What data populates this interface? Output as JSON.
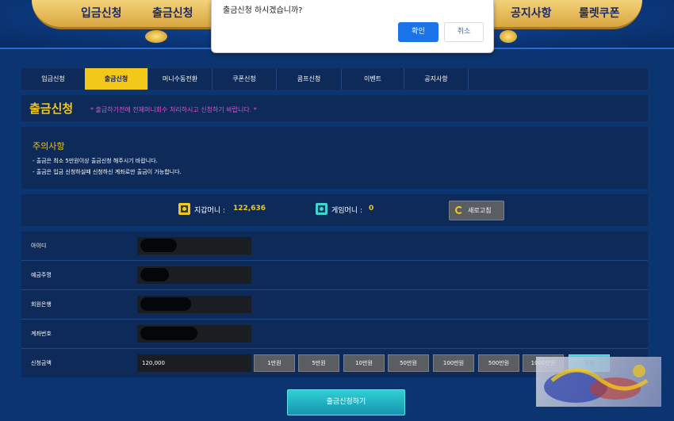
{
  "topnav": {
    "items": [
      "입금신청",
      "출금신청",
      "공지사항",
      "룰렛쿠폰"
    ]
  },
  "tabs": [
    "입금신청",
    "출금신청",
    "머니수동전환",
    "쿠폰신청",
    "콤프신청",
    "이벤트",
    "공지사항"
  ],
  "active_tab": "출금신청",
  "title": {
    "text": "출금신청",
    "note": "* 출금하기전에 전체머니회수 처리하시고 신청하기 바랍니다. *"
  },
  "notice": {
    "title": "주의사항",
    "lines": [
      "- 출금은 최소 5만원이상 출금신청 해주시기 바랍니다.",
      "- 출금은 입금 신청하실때 신청하신 계좌로만 출금이 가능합니다."
    ]
  },
  "wallet": {
    "wallet_label": "지갑머니 :",
    "wallet_value": "122,636",
    "game_label": "게임머니 :",
    "game_value": "0",
    "refresh_label": "새로고침"
  },
  "form": {
    "id_label": "아이디",
    "holder_label": "예금주명",
    "bank_label": "회원은행",
    "account_label": "계좌번호",
    "amount_label": "신청금액",
    "amount_value": "120,000"
  },
  "amount_buttons": [
    "1만원",
    "5만원",
    "10만원",
    "50만원",
    "100만원",
    "500만원",
    "1000만원"
  ],
  "reset_button": "정정",
  "submit_label": "출금신청하기",
  "dialog": {
    "message": "출금신청 하시겠습니까?",
    "ok": "확인",
    "cancel": "취소"
  },
  "colors": {
    "background": "#0a2a5e",
    "accent_yellow": "#f2c81a",
    "note_pink": "#e94bd4",
    "submit_cyan": "#2fd0d4",
    "dialog_blue": "#1a73e8"
  },
  "icons": [
    "wallet-icon",
    "game-money-icon",
    "refresh-icon"
  ]
}
